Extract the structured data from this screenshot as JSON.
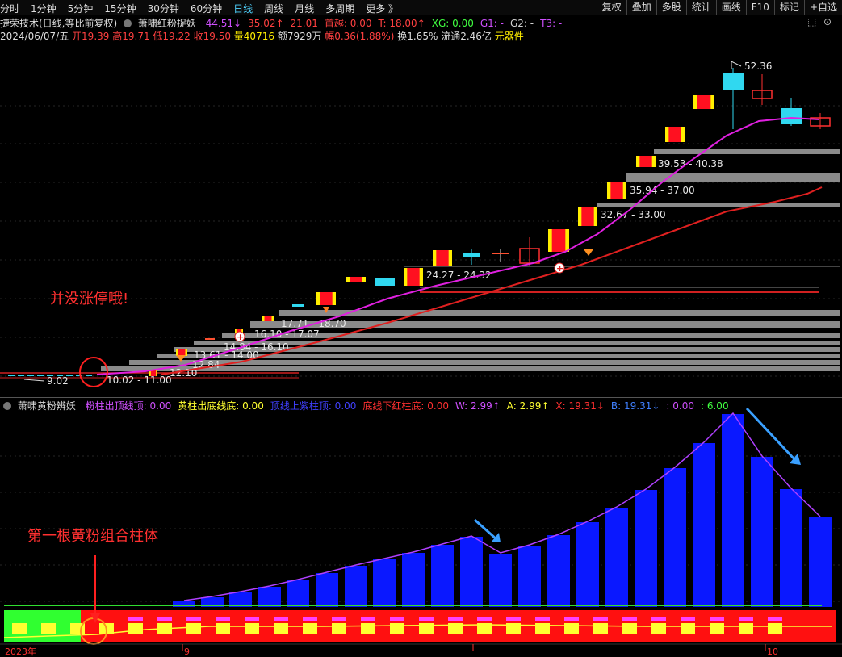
{
  "toolbar": {
    "periods": [
      "分时",
      "1分钟",
      "5分钟",
      "15分钟",
      "30分钟",
      "60分钟",
      "日线",
      "周线",
      "月线",
      "多周期",
      "更多"
    ],
    "active_period": "日线",
    "more_suffix": "》",
    "right_buttons": [
      "复权",
      "叠加",
      "多股",
      "统计",
      "画线",
      "F10",
      "标记",
      "+自选"
    ]
  },
  "title": {
    "stock": "捷荣技术(日线,等比前复权)",
    "indicator": "萧啸红粉捉妖",
    "values": [
      {
        "text": "44.51↓",
        "color": "#d050ff"
      },
      {
        "text": "35.02↑",
        "color": "#ff4040"
      },
      {
        "text": "21.01",
        "color": "#ff4040"
      },
      {
        "text": "首越: 0.00",
        "color": "#ff4040"
      },
      {
        "text": "T: 18.00↑",
        "color": "#ff4040"
      },
      {
        "text": "XG: 0.00",
        "color": "#40ff40"
      },
      {
        "text": "G1: -",
        "color": "#d050ff"
      },
      {
        "text": "G2: -",
        "color": "#d0d0d0"
      },
      {
        "text": "T3: -",
        "color": "#d050ff"
      }
    ]
  },
  "info": {
    "date": "2024/06/07/五",
    "open": "开19.39",
    "high": "高19.71",
    "low": "低19.22",
    "close": "收19.50",
    "volume": "量40716",
    "amount": "额7929万",
    "amplitude": "幅0.36(1.88%)",
    "turnover": "换1.65%",
    "float": "流通2.46亿",
    "sector": "元器件"
  },
  "indicator_bar": {
    "name": "萧啸黄粉辨妖",
    "items": [
      {
        "text": "粉柱出顶线顶: 0.00",
        "color": "#d050ff"
      },
      {
        "text": "黄柱出底线底: 0.00",
        "color": "#ffff30"
      },
      {
        "text": "顶线上紫柱顶: 0.00",
        "color": "#4040ff"
      },
      {
        "text": "底线下红柱底: 0.00",
        "color": "#ff3030"
      },
      {
        "text": "W: 2.99↑",
        "color": "#d050ff"
      },
      {
        "text": "A: 2.99↑",
        "color": "#ffff30"
      },
      {
        "text": "X: 19.31↓",
        "color": "#ff3030"
      },
      {
        "text": "B: 19.31↓",
        "color": "#4080ff"
      },
      {
        "text": ": 0.00",
        "color": "#d050ff"
      },
      {
        "text": ": 6.00",
        "color": "#40ff40"
      }
    ]
  },
  "annotations": {
    "no_limit_up": "并没涨停哦!",
    "first_bar": "第一根黄粉组合柱体"
  },
  "price_labels": {
    "high_mark": "52.36",
    "low_mark": "9.02",
    "zones": [
      "39.53 - 40.38",
      "35.94 - 37.00",
      "32.67 - 33.00",
      "24.27 - 24.32",
      "17.71 - 18.70",
      "16.10 - 17.07",
      "14.84 - 16.10",
      "13.61 - 14.00",
      "12.84",
      "12.10",
      "10.02 - 11.00"
    ]
  },
  "axis": {
    "year_label": "2023年",
    "month_labels": [
      "9",
      "10"
    ]
  },
  "colors": {
    "yang": "#ffee00",
    "yang_core": "#ff1020",
    "pink_line": "#e020e0",
    "red_line": "#e02020",
    "blue_bar": "#0a18ff",
    "cyan_candle": "#30d8f0"
  }
}
